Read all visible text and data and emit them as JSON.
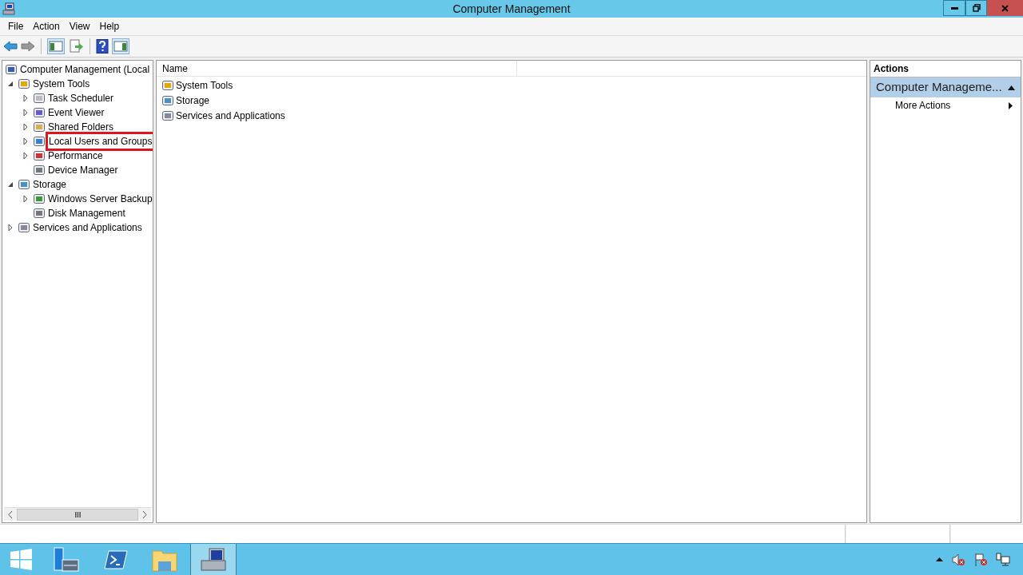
{
  "window": {
    "title": "Computer Management"
  },
  "menu": [
    "File",
    "Action",
    "View",
    "Help"
  ],
  "tree": [
    {
      "label": "Computer Management (Local",
      "highlighted": false,
      "children": [
        {
          "label": "System Tools",
          "expanded": true,
          "highlighted": false,
          "children": [
            {
              "label": "Task Scheduler",
              "expanded": false,
              "highlighted": false
            },
            {
              "label": "Event Viewer",
              "expanded": false,
              "highlighted": false
            },
            {
              "label": "Shared Folders",
              "expanded": false,
              "highlighted": false
            },
            {
              "label": "Local Users and Groups",
              "expanded": false,
              "highlighted": true
            },
            {
              "label": "Performance",
              "expanded": false,
              "highlighted": false
            },
            {
              "label": "Device Manager",
              "highlighted": false
            }
          ]
        },
        {
          "label": "Storage",
          "expanded": true,
          "highlighted": false,
          "children": [
            {
              "label": "Windows Server Backup",
              "expanded": false,
              "highlighted": false
            },
            {
              "label": "Disk Management",
              "highlighted": false
            }
          ]
        },
        {
          "label": "Services and Applications",
          "expanded": false,
          "highlighted": false
        }
      ]
    }
  ],
  "list": {
    "columns": [
      "Name"
    ],
    "rows": [
      "System Tools",
      "Storage",
      "Services and Applications"
    ]
  },
  "actions": {
    "header": "Actions",
    "section": "Computer Manageme...",
    "items": [
      "More Actions"
    ]
  }
}
